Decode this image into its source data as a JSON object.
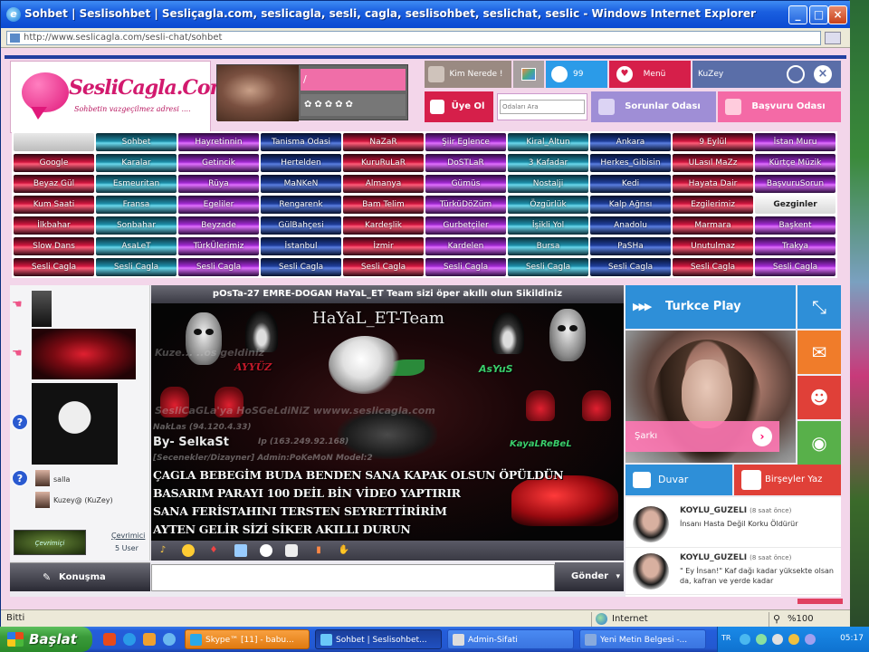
{
  "window": {
    "title": "Sohbet | Seslisohbet | Sesliçagla.com, seslicagla, sesli, cagla, seslisohbet, seslichat, seslic - Windows Internet Explorer",
    "address": "http://www.seslicagla.com/sesli-chat/sohbet",
    "minimize": "_",
    "maximize": "□",
    "close": "×"
  },
  "site": {
    "logo_name": "SesliCagla.Com",
    "logo_slogan": "Sohbetin vazgeçilmez adresi ....",
    "profile_name": "/",
    "profile_stars": "✿✿✿✿✿",
    "kim_label": "Kim Nerede !",
    "online_count": "99",
    "menu_label": "Menü",
    "user_label": "KuZey",
    "uye_label": "Üye Ol",
    "search_placeholder": "Odaları Ara",
    "sorun_label": "Sorunlar Odası",
    "basvuru_label": "Başvuru Odası"
  },
  "rooms": [
    [
      "Sohbet",
      "Hayretinnin",
      "Tanisma Odasi",
      "NaZaR",
      "Şiir Eglence",
      "Kiral_Altun",
      "Ankara",
      "9 Eylül",
      "İstan Muru"
    ],
    [
      "Google",
      "Karalar",
      "Getincik",
      "Hertelden",
      "KuruRuLaR",
      "DoSTLaR",
      "3 Kafadar",
      "Herkes_Gibisin",
      "ULasıl MaZz",
      "Kürtçe Müzik"
    ],
    [
      "Beyaz Gül",
      "Esmeuritan",
      "Rüya",
      "MaNKeN",
      "Almanya",
      "Gümüs",
      "Nostalji",
      "Kedi",
      "Hayata Dair",
      "BaşvuruSorun"
    ],
    [
      "Kum Saati",
      "Fransa",
      "Egeliler",
      "Rengarenk",
      "Bam Telim",
      "TürküDöZüm",
      "Özgürlük",
      "Kalp Ağrısı",
      "Ezgilerimiz",
      "Gezginler"
    ],
    [
      "İlkbahar",
      "Sonbahar",
      "Beyzade",
      "GülBahçesi",
      "Kardeşlik",
      "Gurbetçiler",
      "İşikli Yol",
      "Anadolu",
      "Marmara",
      "Başkent"
    ],
    [
      "Slow Dans",
      "AsaLeT",
      "TürkÜlerimiz",
      "İstanbul",
      "İzmir",
      "Kardelen",
      "Bursa",
      "PaSHa",
      "Unutulmaz",
      "Trakya"
    ],
    [
      "Sesli Cagla",
      "Sesli Cagla",
      "Sesli Cagla",
      "Sesli Cagla",
      "Sesli Cagla",
      "Sesli Cagla",
      "Sesli Cagla",
      "Sesli Cagla",
      "Sesli Cagla",
      "Sesli Cagla"
    ]
  ],
  "userlist": {
    "users": [
      {
        "name": "salla"
      },
      {
        "name": "Kuzey@ (KuZey)"
      }
    ],
    "logo_text": "Çevrimiçi",
    "cevrimici": "Çevrimici",
    "count": "5 User"
  },
  "chat": {
    "header": "pOsTa-27 EMRE-DOGAN HaYaL_ET Team sizi öper akıllı olun Sikildiniz",
    "banner_title": "HaYaL_ET-Team",
    "watermark1": "Kuze... ..os geldiniz",
    "watermark2": "SesliCaGLa'ya HoSGeLdiNiZ wwww.seslicagla.com",
    "nick1": "AsYuS",
    "nick2": "KayaLReBeL",
    "by_line": "By- SelkaSt",
    "info1": "NakLas (94.120.4.33)",
    "info2": "Ip (163.249.92.168)",
    "info3": "[Secenekler/Dizayner] Admin:PoKeMoN Model:2",
    "msg1": "ÇAGLA BEBEGİM BUDA BENDEN SANA KAPAK OLSUN ÖPÜLDÜN",
    "msg2": "BASARIM PARAYI 100 DEİL BİN VİDEO YAPTIRIR",
    "msg3": "SANA FERİSTAHINI TERSTEN SEYRETTİRİRİM",
    "msg4": "AYTEN GELİR SİZİ SİKER AKILLI DURUN",
    "konusma_label": "Konuşma",
    "send_label": "Gönder"
  },
  "right": {
    "radio_label": "Turkce Play",
    "song_label": "Şarkı",
    "duvar_label": "Duvar",
    "yaz_label": "Birşeyler Yaz",
    "posts": [
      {
        "name": "KOYLU_GUZELI",
        "time": "(8 saat önce)",
        "text": "İnsanı Hasta Değil Korku Öldürür"
      },
      {
        "name": "KOYLU_GUZELI",
        "time": "(8 saat önce)",
        "text": "\" Ey İnsan!\" Kaf dağı kadar yüksekte olsan da, kafran ve yerde kadar"
      }
    ]
  },
  "statusbar": {
    "done": "Bitti",
    "zone": "Internet",
    "zoom": "%100"
  },
  "taskbar": {
    "start": "Başlat",
    "tasks": [
      "Skype™ [11] - babu...",
      "Sohbet | Seslisohbet...",
      "Admin-Sifati",
      "Yeni Metin Belgesi -..."
    ],
    "lang": "TR",
    "clock": "05:17"
  },
  "colors": {
    "pink_bg": "#f3d6ea",
    "brand_pink": "#d21a6e",
    "accent_blue": "#2e8fd8",
    "accent_red": "#d61f4a"
  }
}
